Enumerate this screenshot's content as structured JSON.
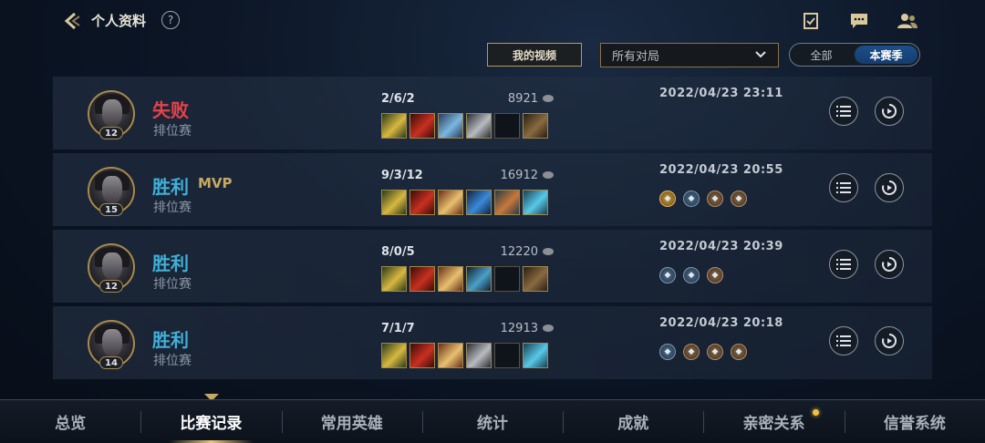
{
  "header": {
    "title": "个人资料",
    "help_label": "?"
  },
  "filters": {
    "video_button": "我的视频",
    "mode_select": "所有对局",
    "season_options": [
      "全部",
      "本赛季"
    ],
    "season_active": "本赛季"
  },
  "matches": [
    {
      "result": "失败",
      "result_type": "loss",
      "mvp": "",
      "mode": "排位赛",
      "level": "12",
      "kda": "2/6/2",
      "gold": "8921",
      "datetime": "2022/04/23 23:11",
      "items": [
        "gold-tri",
        "red-blade",
        "crystal-ball",
        "sword",
        "empty",
        "boots"
      ],
      "badges": []
    },
    {
      "result": "胜利",
      "result_type": "win",
      "mvp": "MVP",
      "mode": "排位赛",
      "level": "15",
      "kda": "9/3/12",
      "gold": "16912",
      "datetime": "2022/04/23 20:55",
      "items": [
        "gold-tri",
        "red-blade",
        "wings",
        "blue-axe",
        "armor",
        "ice-hammer"
      ],
      "badges": [
        "gold-b",
        "blue-b",
        "bronze-b",
        "bronze-b"
      ]
    },
    {
      "result": "胜利",
      "result_type": "win",
      "mvp": "",
      "mode": "排位赛",
      "level": "12",
      "kda": "8/0/5",
      "gold": "12220",
      "datetime": "2022/04/23 20:39",
      "items": [
        "gold-tri",
        "red-blade",
        "wings",
        "spear",
        "empty",
        "boots"
      ],
      "badges": [
        "blue-b",
        "blue-b",
        "bronze-b"
      ]
    },
    {
      "result": "胜利",
      "result_type": "win",
      "mvp": "",
      "mode": "排位赛",
      "level": "14",
      "kda": "7/1/7",
      "gold": "12913",
      "datetime": "2022/04/23 20:18",
      "items": [
        "gold-tri",
        "red-blade",
        "wings",
        "sword",
        "empty",
        "ice-hammer"
      ],
      "badges": [
        "blue-b",
        "bronze-b",
        "bronze-b",
        "bronze-b"
      ]
    }
  ],
  "bottom_nav": [
    "总览",
    "比赛记录",
    "常用英雄",
    "统计",
    "成就",
    "亲密关系",
    "信誉系统"
  ],
  "bottom_nav_active": "比赛记录",
  "colors": {
    "loss": "#e8424a",
    "win": "#3fb0d8",
    "accent": "#c8a860"
  }
}
